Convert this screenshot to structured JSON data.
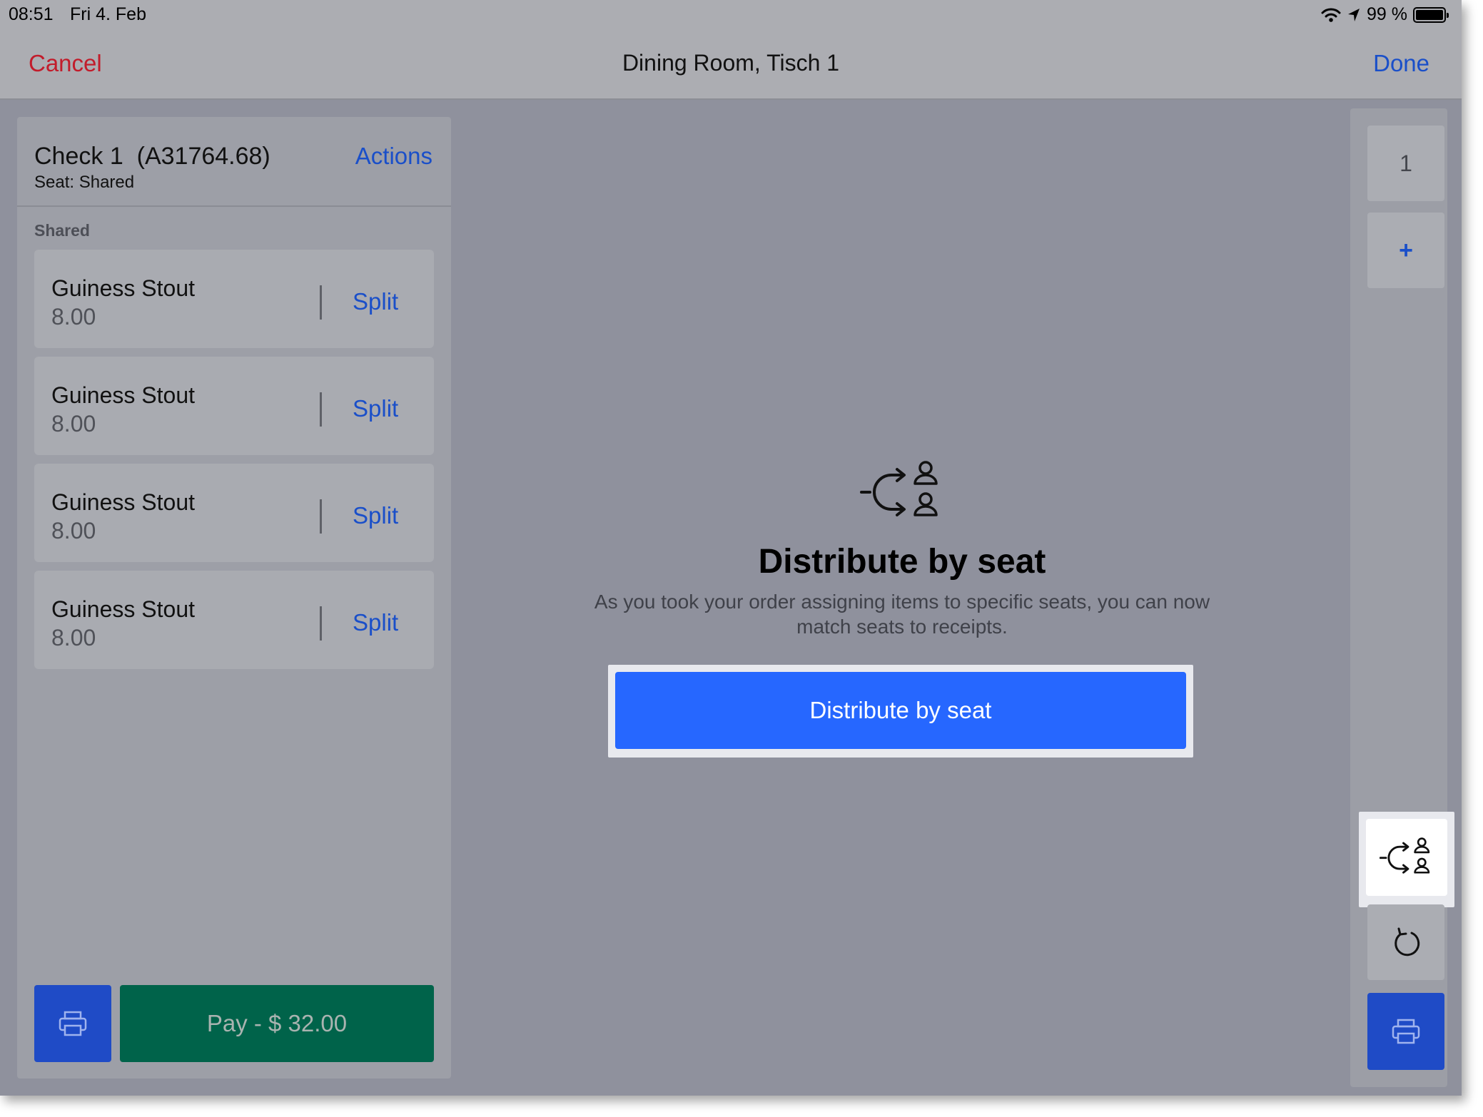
{
  "status_bar": {
    "time": "08:51",
    "date": "Fri 4. Feb",
    "battery_text": "99 %"
  },
  "nav": {
    "cancel_label": "Cancel",
    "title": "Dining Room, Tisch 1",
    "done_label": "Done"
  },
  "check": {
    "title": "Check 1  (A31764.68)",
    "seat": "Seat: Shared",
    "actions_label": "Actions",
    "section_label": "Shared",
    "items": [
      {
        "name": "Guiness Stout",
        "price": "8.00",
        "split_label": "Split"
      },
      {
        "name": "Guiness Stout",
        "price": "8.00",
        "split_label": "Split"
      },
      {
        "name": "Guiness Stout",
        "price": "8.00",
        "split_label": "Split"
      },
      {
        "name": "Guiness Stout",
        "price": "8.00",
        "split_label": "Split"
      }
    ],
    "pay_label": "Pay - $ 32.00"
  },
  "distribute": {
    "title": "Distribute by seat",
    "description": "As you took your order assigning items to specific seats, you can now match seats to receipts.",
    "button_label": "Distribute by seat"
  },
  "rail": {
    "seat_tab_label": "1",
    "add_tab_label": "+"
  },
  "colors": {
    "accent_blue": "#2667ff",
    "link_blue": "#1a4fc9",
    "cancel_red": "#c21c2b",
    "pay_green": "#00634a"
  },
  "icons": {
    "status": [
      "wifi-icon",
      "location-icon",
      "battery-icon"
    ],
    "print": "printer-icon",
    "distribute": "distribute-seats-icon",
    "undo": "undo-icon"
  }
}
